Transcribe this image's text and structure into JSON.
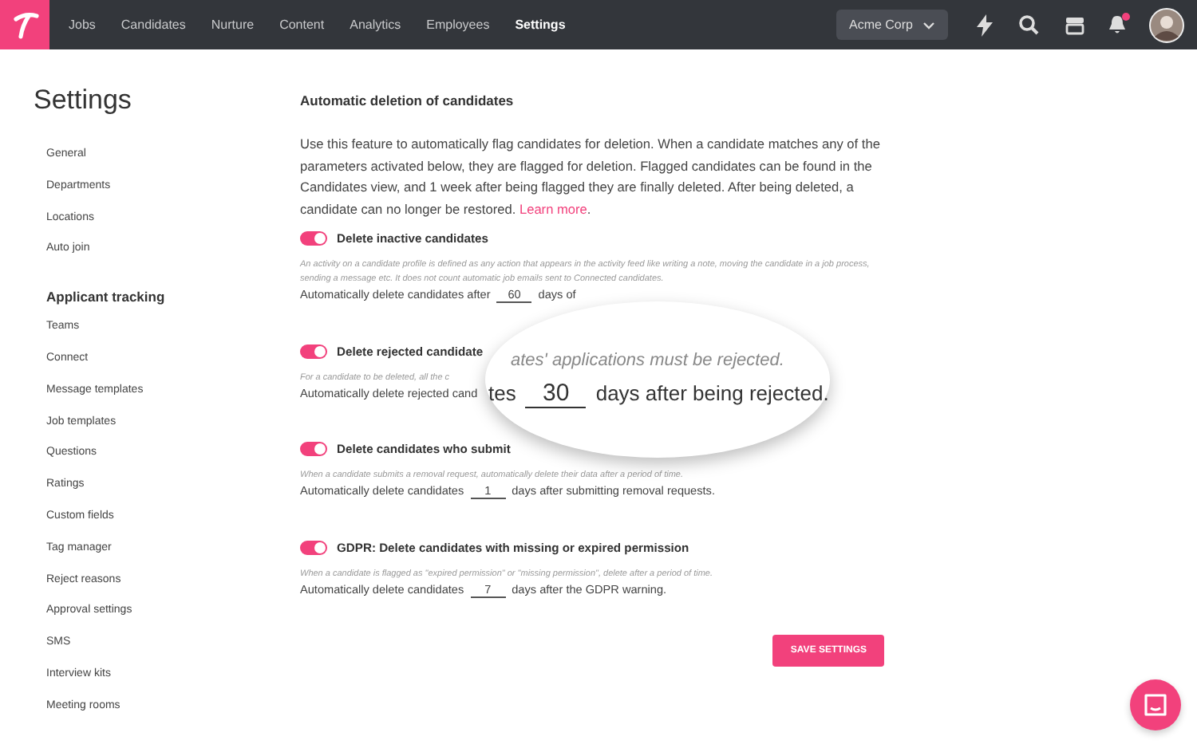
{
  "nav": {
    "items": [
      {
        "label": "Jobs",
        "selected": false
      },
      {
        "label": "Candidates",
        "selected": false
      },
      {
        "label": "Nurture",
        "selected": false
      },
      {
        "label": "Content",
        "selected": false
      },
      {
        "label": "Analytics",
        "selected": false
      },
      {
        "label": "Employees",
        "selected": false
      },
      {
        "label": "Settings",
        "selected": true
      }
    ],
    "company": "Acme Corp",
    "notification": true
  },
  "sidebar": {
    "title": "Settings",
    "groups": [
      {
        "items": [
          "General",
          "Departments",
          "Locations",
          "Auto join"
        ]
      },
      {
        "heading": "Applicant tracking",
        "items": [
          "Teams",
          "Connect",
          "Message templates",
          "Job templates",
          "Questions",
          "Ratings",
          "Custom fields",
          "Tag manager",
          "Reject reasons",
          "Approval settings",
          "SMS",
          "Interview kits",
          "Meeting rooms"
        ]
      }
    ]
  },
  "main": {
    "title": "Automatic deletion of candidates",
    "intro": "Use this feature to automatically flag candidates for deletion. When a candidate matches any of the parameters activated below, they are flagged for deletion. Flagged candidates can be found in the Candidates view, and 1 week after being flagged they are finally deleted. After being deleted, a candidate can no longer be restored.",
    "link": "Learn more",
    "link_suffix": ".",
    "settings": [
      {
        "title": "Delete inactive candidates",
        "on": true,
        "description": "An activity on a candidate profile is defined as any action that appears in the activity feed like writing a note, moving the candidate in a job process, sending a message etc. It does not count automatic job emails sent to Connected candidates.",
        "before": "Automatically delete candidates after",
        "value": "60",
        "after": "days of"
      },
      {
        "title": "Delete rejected candidate",
        "on": true,
        "description": "For a candidate to be deleted, all the c",
        "before": "Automatically delete rejected cand"
      },
      {
        "title": "Delete candidates who submit",
        "on": true,
        "description": "When a candidate submits a removal request, automatically delete their data after a period of time.",
        "before": "Automatically delete candidates",
        "value": "1",
        "after": "days after submitting removal requests."
      },
      {
        "title": "GDPR: Delete candidates with missing or expired permission",
        "on": true,
        "description": "When a candidate is flagged as \"expired permission\" or \"missing permission\", delete after a period of time.",
        "before": "Automatically delete candidates",
        "value": "7",
        "after": "days after the GDPR warning."
      }
    ],
    "save": "SAVE SETTINGS"
  },
  "magnifier": {
    "line": "ates' applications must be rejected.",
    "before": "tes",
    "value": "30",
    "after": "days after being rejected."
  }
}
